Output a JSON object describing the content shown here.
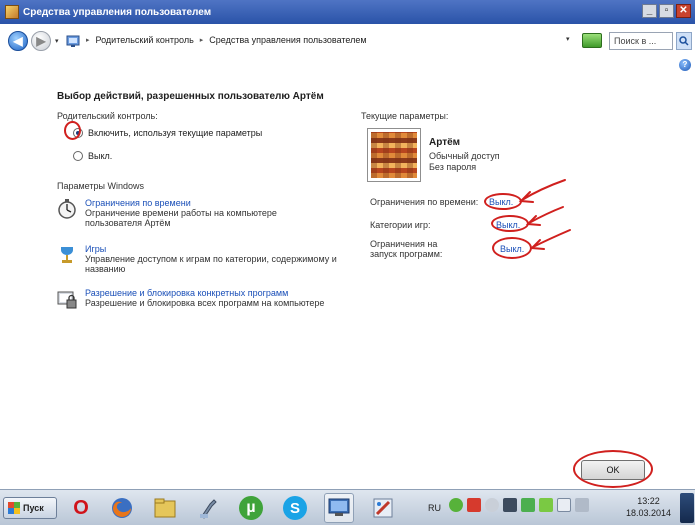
{
  "window": {
    "title": "Средства управления пользователем",
    "controls": {
      "minimize": "_",
      "maximize": "▫",
      "close": "✕"
    }
  },
  "address_bar": {
    "back_glyph": "◀",
    "forward_glyph": "▶",
    "dropdown_glyph": "▾",
    "breadcrumb": [
      "Родительский контроль",
      "Средства управления пользователем"
    ],
    "breadcrumb_separator": "▸",
    "search_placeholder": "Поиск в ...",
    "help_glyph": "?"
  },
  "content": {
    "title": "Выбор действий, разрешенных пользователю Артём",
    "parental_control_label": "Родительский контроль:",
    "radio_on": {
      "label": "Включить, используя текущие параметры",
      "checked": true
    },
    "radio_off": {
      "label": "Выкл.",
      "checked": false
    },
    "windows_params_label": "Параметры Windows",
    "settings": [
      {
        "icon": "stopwatch-icon",
        "link": "Ограничения по времени",
        "desc": [
          "Ограничение времени работы на компьютере",
          "пользователя Артём"
        ]
      },
      {
        "icon": "games-icon",
        "link": "Игры",
        "desc": [
          "Управление доступом к играм по категории, содержимому и",
          "названию"
        ]
      },
      {
        "icon": "program-block-icon",
        "link": "Разрешение и блокировка конкретных программ",
        "desc": [
          "Разрешение и блокировка всех программ на компьютере"
        ]
      }
    ],
    "current_params_label": "Текущие параметры:",
    "user": {
      "name": "Артём",
      "type": "Обычный доступ",
      "password": "Без пароля"
    },
    "status": [
      {
        "label": [
          "Ограничения по времени:"
        ],
        "value": "Выкл."
      },
      {
        "label": [
          "Категории игр:"
        ],
        "value": "Выкл."
      },
      {
        "label": [
          "Ограничения на",
          "запуск программ:"
        ],
        "value": "Выкл."
      }
    ],
    "ok_label": "OK"
  },
  "annotations": {
    "color": "#d0201e"
  },
  "taskbar": {
    "start_label": "Пуск",
    "apps": [
      {
        "name": "opera-icon",
        "glyph": "O",
        "color": "#d0131a"
      },
      {
        "name": "firefox-icon",
        "glyph": "",
        "color": "#e8751a"
      },
      {
        "name": "file-explorer-icon",
        "glyph": "",
        "color": "#e5c65a"
      },
      {
        "name": "tool-icon",
        "glyph": "",
        "color": "#7b8fa8"
      },
      {
        "name": "utorrent-icon",
        "glyph": "µ",
        "color": "#3fa33a"
      },
      {
        "name": "skype-icon",
        "glyph": "S",
        "color": "#1aa3e6"
      },
      {
        "name": "control-panel-icon",
        "glyph": "",
        "color": "#3c6fb4"
      },
      {
        "name": "paint-icon",
        "glyph": "",
        "color": "#9fb8d8"
      }
    ],
    "language": "RU",
    "tray_icons": [
      "tray-shield-icon",
      "tray-red-icon",
      "volume-icon",
      "network-icon",
      "tray-green-icon",
      "tray-flag-icon",
      "action-center-icon",
      "tray-device-icon"
    ],
    "time": "13:22",
    "date": "18.03.2014"
  }
}
